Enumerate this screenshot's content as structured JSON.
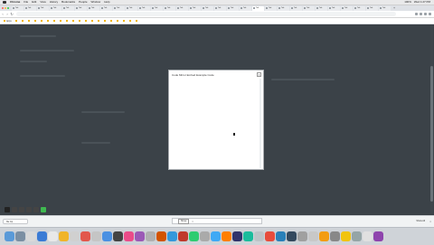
{
  "menubar": {
    "items": [
      "Chrome",
      "File",
      "Edit",
      "View",
      "History",
      "Bookmarks",
      "People",
      "Window",
      "Help"
    ],
    "right": [
      "100%",
      "Wed 1:27 PM"
    ]
  },
  "tabs": [
    {
      "label": "Tab"
    },
    {
      "label": "Tab"
    },
    {
      "label": "Tab"
    },
    {
      "label": "Tab"
    },
    {
      "label": "Tab"
    },
    {
      "label": "Tab"
    },
    {
      "label": "Tab"
    },
    {
      "label": "Tab"
    },
    {
      "label": "Tab"
    },
    {
      "label": "Tab"
    },
    {
      "label": "Tab"
    },
    {
      "label": "Tab"
    },
    {
      "label": "Tab"
    },
    {
      "label": "Tab"
    },
    {
      "label": "Tab"
    },
    {
      "label": "Tab"
    },
    {
      "label": "Tab"
    },
    {
      "label": "Tab"
    },
    {
      "label": "Tab"
    },
    {
      "label": "Tab",
      "active": true
    },
    {
      "label": "Tab"
    },
    {
      "label": "Tab"
    },
    {
      "label": "Tab"
    },
    {
      "label": "Tab"
    },
    {
      "label": "Tab"
    },
    {
      "label": "Tab"
    },
    {
      "label": "Tab"
    },
    {
      "label": "Tab"
    },
    {
      "label": "Tab"
    },
    {
      "label": "Tab"
    }
  ],
  "toolbar": {
    "back": "‹",
    "forward": "›",
    "reload": "↻",
    "url": ""
  },
  "bookmarks": [
    "Apps",
    "",
    "",
    "",
    "",
    "",
    "",
    "",
    "",
    "",
    "",
    "",
    "",
    "",
    "",
    "",
    "",
    "",
    "",
    "",
    ""
  ],
  "modal": {
    "title": "Code Mirror Embed Example Code",
    "close": "×"
  },
  "downloads": {
    "item": "file.zip",
    "toast": "",
    "toast_button": "Show",
    "toast_close": "×",
    "show_all": "Show All",
    "close": "×"
  },
  "colors": {
    "page_bg": "#3b4248",
    "modal_bg": "#ffffff"
  }
}
